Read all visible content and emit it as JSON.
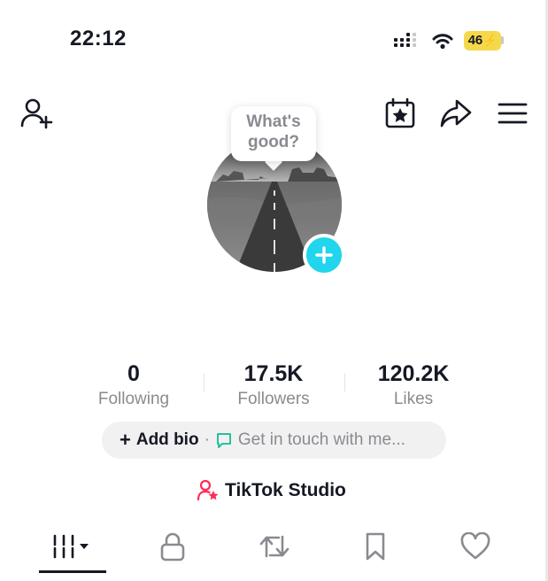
{
  "status_bar": {
    "time": "22:12",
    "battery_level": "46",
    "icons": [
      "signal-icon",
      "wifi-icon",
      "battery-charging-icon"
    ],
    "battery_color": "#f5d94a"
  },
  "header": {
    "icons": [
      "add-friend-icon",
      "calendar-star-icon",
      "share-icon",
      "menu-icon"
    ]
  },
  "profile": {
    "bubble_line1": "What's",
    "bubble_line2": "good?",
    "add_photo_color": "#20d5ec"
  },
  "stats": [
    {
      "value": "0",
      "label": "Following"
    },
    {
      "value": "17.5K",
      "label": "Followers"
    },
    {
      "value": "120.2K",
      "label": "Likes"
    }
  ],
  "bio": {
    "plus": "+",
    "add_label": "Add bio",
    "separator": "·",
    "touch_label": "Get in touch with me..."
  },
  "studio": {
    "label": "TikTok Studio",
    "icon_color": "#fe2c55"
  },
  "tabs": [
    "videos-grid-icon",
    "lock-icon",
    "repost-icon",
    "bookmark-icon",
    "heart-icon"
  ],
  "colors": {
    "text_primary": "#161823",
    "text_secondary": "#8a8b91",
    "accent_cyan": "#20d5ec",
    "bio_chat_icon": "#25c2a0"
  }
}
